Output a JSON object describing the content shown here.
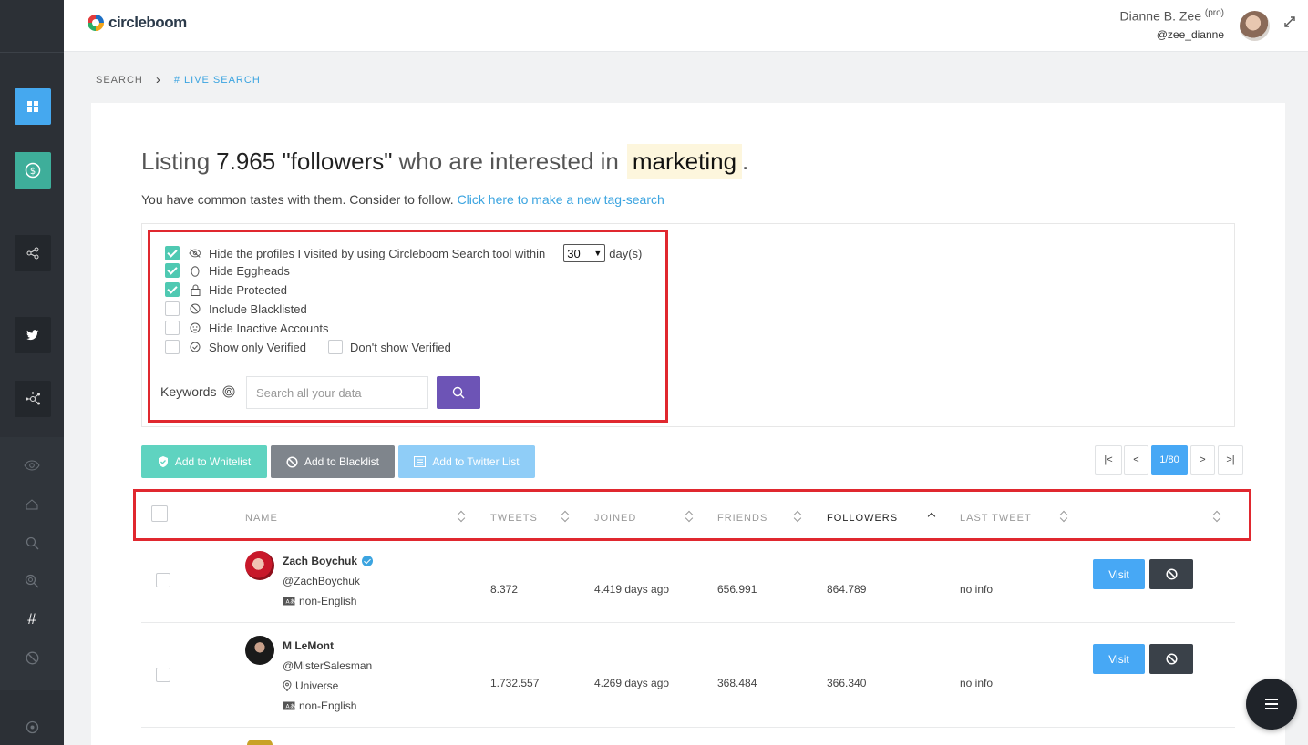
{
  "brand": {
    "name": "circleboom"
  },
  "user": {
    "name": "Dianne B. Zee",
    "badge": "(pro)",
    "handle": "@zee_dianne"
  },
  "breadcrumb": {
    "root": "SEARCH",
    "separator": "›",
    "current": "# LIVE SEARCH"
  },
  "headline": {
    "prefix": "Listing",
    "count_phrase": "7.965 \"followers\"",
    "middle": "who are interested in",
    "tag": "marketing",
    "suffix": "."
  },
  "subline": {
    "text": "You have common tastes with them. Consider to follow.",
    "link": "Click here to make a new tag-search"
  },
  "filters": {
    "hide_visited": {
      "label": "Hide the profiles I visited by using Circleboom Search tool within",
      "checked": true,
      "icon": "eye-slash-icon"
    },
    "days": {
      "value": "30",
      "unit": "day(s)"
    },
    "hide_eggheads": {
      "label": "Hide Eggheads",
      "checked": true,
      "icon": "egg-icon"
    },
    "hide_protected": {
      "label": "Hide Protected",
      "checked": true,
      "icon": "lock-icon"
    },
    "include_blacklisted": {
      "label": "Include Blacklisted",
      "checked": false,
      "icon": "ban-icon"
    },
    "hide_inactive": {
      "label": "Hide Inactive Accounts",
      "checked": false,
      "icon": "face-icon"
    },
    "show_verified": {
      "label": "Show only Verified",
      "checked": false,
      "icon": "verified-icon"
    },
    "dont_show_verified": {
      "label": "Don't show Verified",
      "checked": false
    }
  },
  "keywords": {
    "label": "Keywords",
    "placeholder": "Search all your data"
  },
  "actions": {
    "whitelist": "Add to Whitelist",
    "blacklist": "Add to Blacklist",
    "twitter_list": "Add to Twitter List"
  },
  "pagination": {
    "first": "|<",
    "prev": "<",
    "current": "1/80",
    "next": ">",
    "last": ">|"
  },
  "table": {
    "columns": [
      "NAME",
      "TWEETS",
      "JOINED",
      "FRIENDS",
      "FOLLOWERS",
      "LAST TWEET"
    ],
    "sorted_column": "FOLLOWERS",
    "rows": [
      {
        "name": "Zach Boychuk",
        "verified": true,
        "handle": "@ZachBoychuk",
        "location": "",
        "language": "non-English",
        "tweets": "8.372",
        "joined": "4.419 days ago",
        "friends": "656.991",
        "followers": "864.789",
        "last_tweet": "no info",
        "visit": "Visit"
      },
      {
        "name": "M LeMont",
        "verified": false,
        "handle": "@MisterSalesman",
        "location": "Universe",
        "language": "non-English",
        "tweets": "1.732.557",
        "joined": "4.269 days ago",
        "friends": "368.484",
        "followers": "366.340",
        "last_tweet": "no info",
        "visit": "Visit"
      }
    ]
  },
  "colors": {
    "accent": "#47a8f5",
    "teal": "#4fc9b2",
    "purple": "#6d54b6",
    "highlight": "#e0282f",
    "sidebar": "#2c3036"
  }
}
